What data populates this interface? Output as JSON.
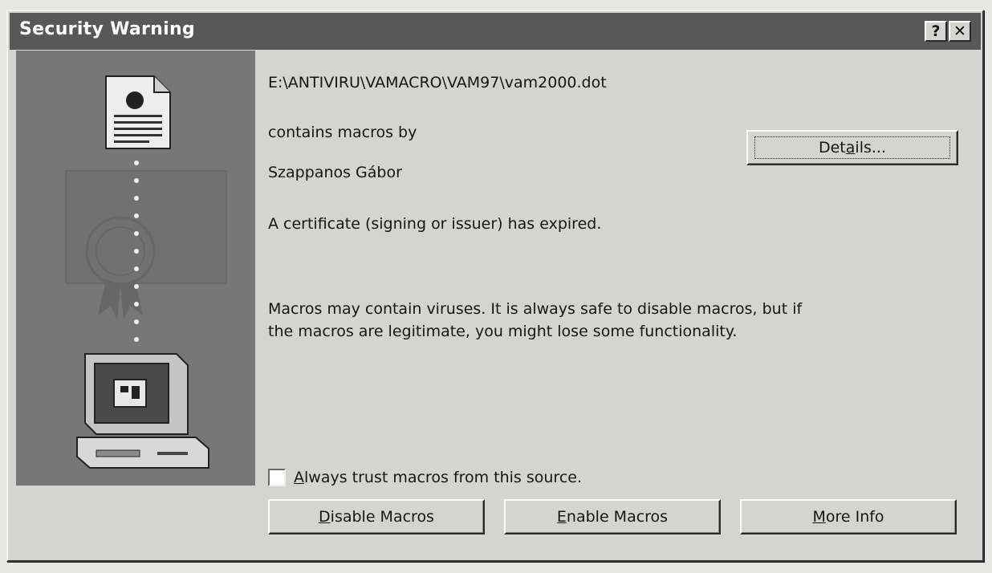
{
  "window": {
    "title": "Security Warning",
    "help_button": "?",
    "close_button": "✕"
  },
  "content": {
    "file_path": "E:\\ANTIVIRU\\VAMACRO\\VAM97\\vam2000.dot",
    "contains_label": "contains macros by",
    "publisher": "Szappanos Gábor",
    "certificate_message": "A certificate (signing or issuer) has expired.",
    "warning_line1": "Macros may contain viruses. It is always safe to disable macros, but if",
    "warning_line2": "the macros are legitimate, you might lose some functionality."
  },
  "buttons": {
    "details": {
      "pre": "Det",
      "key": "a",
      "post": "ils..."
    },
    "disable": {
      "pre": "",
      "key": "D",
      "post": "isable Macros"
    },
    "enable": {
      "pre": "",
      "key": "E",
      "post": "nable Macros"
    },
    "more_info": {
      "pre": "",
      "key": "M",
      "post": "ore Info"
    }
  },
  "checkbox": {
    "checked": false,
    "label": {
      "pre": "",
      "key": "A",
      "post": "lways trust macros from this source."
    }
  },
  "icons": [
    "document-icon",
    "certificate-icon",
    "computer-icon"
  ]
}
